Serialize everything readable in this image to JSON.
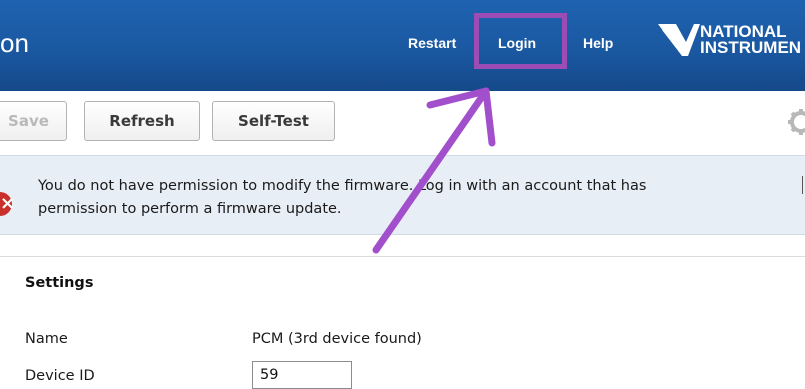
{
  "header": {
    "app_title_fragment": "on",
    "nav": {
      "restart": "Restart",
      "login": "Login",
      "help": "Help"
    },
    "logo": {
      "line1": "NATIONAL",
      "line2": "INSTRUMEN"
    },
    "background_color": "#1a58a1",
    "annotation_color": "#9b4db5"
  },
  "toolbar": {
    "save_label": "Save",
    "refresh_label": "Refresh",
    "selftest_label": "Self-Test",
    "settings_icon": "gear-icon"
  },
  "message": {
    "icon": "error-icon",
    "line1": "You do not have permission to modify the firmware. Log in with an account that has",
    "line2": "permission to perform a firmware update."
  },
  "settings": {
    "title": "Settings",
    "fields": {
      "name_label": "Name",
      "name_value": "PCM (3rd device found)",
      "device_id_label": "Device ID",
      "device_id_value": "59"
    }
  }
}
